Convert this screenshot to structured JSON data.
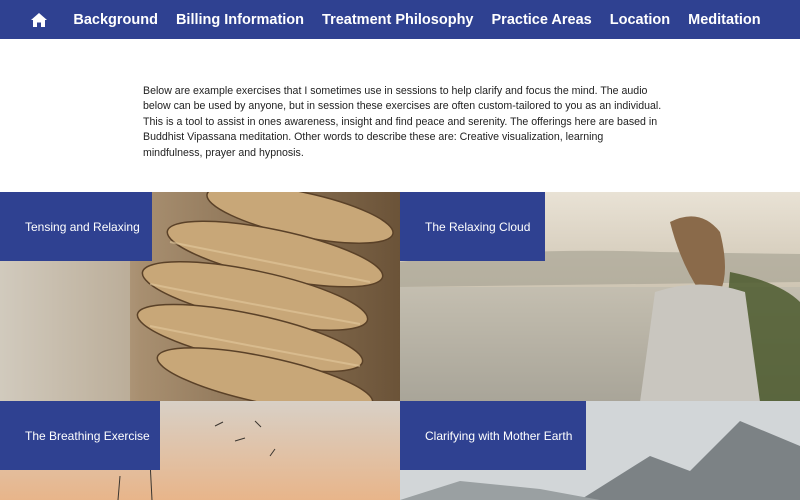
{
  "nav": {
    "home_icon": "home-icon",
    "links": [
      {
        "label": "Background"
      },
      {
        "label": "Billing Information"
      },
      {
        "label": "Treatment Philosophy"
      },
      {
        "label": "Practice Areas"
      },
      {
        "label": "Location"
      },
      {
        "label": "Meditation"
      }
    ]
  },
  "intro": {
    "text": "Below are example exercises that I sometimes use in sessions to help clarify and focus the mind. The audio below can be used by anyone, but in session these exercises are often custom-tailored to you as an individual. This is a tool to assist in ones awareness, insight and find peace and serenity. The offerings here are based in Buddhist Vipassana meditation. Other words to describe these are: Creative visualization, learning mindfulness, prayer and hypnosis."
  },
  "exercises": [
    {
      "title": "Tensing and Relaxing"
    },
    {
      "title": "The Relaxing Cloud"
    },
    {
      "title": "The Breathing Exercise"
    },
    {
      "title": "Clarifying with Mother Earth"
    }
  ],
  "colors": {
    "brand": "#2f4191",
    "text": "#222222",
    "background": "#ffffff"
  }
}
